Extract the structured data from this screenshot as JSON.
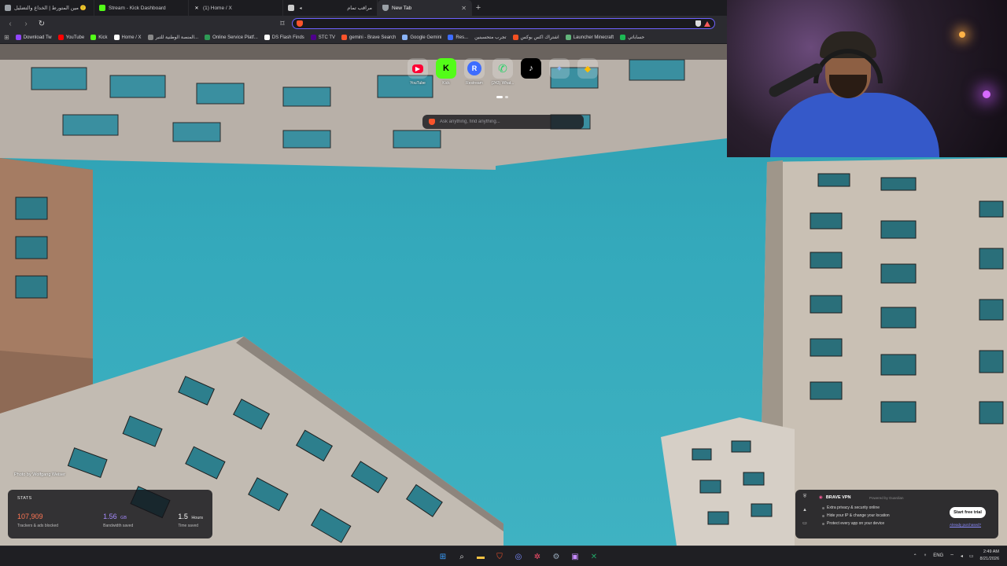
{
  "tabs": [
    {
      "title": "مين المتورط | الخداع والتضليل 🙂",
      "icon_color": "#9aa0a6",
      "active": false
    },
    {
      "title": "Stream - Kick Dashboard",
      "icon_color": "#53fc18",
      "active": false
    },
    {
      "title": "(1) Home / X",
      "icon_color": "#ffffff",
      "active": false
    },
    {
      "title": "مراقب تمام",
      "icon_color": "#cccccc",
      "active": false
    },
    {
      "title": "New Tab",
      "icon_color": "#9aa0a6",
      "active": true
    }
  ],
  "new_tab_symbol": "+",
  "close_symbol": "✕",
  "url": {
    "value": "",
    "placeholder": ""
  },
  "bookmarks": [
    {
      "label": "Download Tw",
      "color": "#9146ff"
    },
    {
      "label": "YouTube",
      "color": "#ff0000"
    },
    {
      "label": "Kick",
      "color": "#53fc18"
    },
    {
      "label": "Home / X",
      "color": "#ffffff"
    },
    {
      "label": "المنصة الوطنية للتبر...",
      "color": "#888888"
    },
    {
      "label": "Online Service Platf...",
      "color": "#2e9a55"
    },
    {
      "label": "DS Flash Finds",
      "color": "#ffffff"
    },
    {
      "label": "STC TV",
      "color": "#4f008c"
    },
    {
      "label": "gemini - Brave Search",
      "color": "#fb542b"
    },
    {
      "label": "Google Gemini",
      "color": "#8ab4f8"
    },
    {
      "label": "Res...",
      "color": "#3d6cff"
    },
    {
      "label": "تجرب متحسبنين",
      "color": "#ff9900"
    },
    {
      "label": "اشتراك اكس بوكس",
      "color": "#f25022"
    },
    {
      "label": "Launcher Minecraft",
      "color": "#62b47a"
    },
    {
      "label": "حساباتي",
      "color": "#1db954"
    }
  ],
  "top_sites": [
    {
      "label": "YouTube",
      "glyph": "▶",
      "bg": "#ff0033",
      "fg": "#ffffff"
    },
    {
      "label": "Kick",
      "glyph": "K",
      "bg": "#53fc18",
      "fg": "#000000"
    },
    {
      "label": "Restream",
      "glyph": "R",
      "bg": "#3d6cff",
      "fg": "#ffffff"
    },
    {
      "label": "(243) What...",
      "glyph": "✆",
      "bg": "#25d366",
      "fg": "#ffffff"
    },
    {
      "label": "",
      "glyph": "♪",
      "bg": "#000000",
      "fg": "#ffffff"
    },
    {
      "label": "",
      "glyph": "✦",
      "bg": "#8ab4f8",
      "fg": "#ffffff"
    },
    {
      "label": "",
      "glyph": "◆",
      "bg": "#34a853",
      "fg": "#fbbc04"
    }
  ],
  "search": {
    "placeholder": "Ask anything, find anything..."
  },
  "photo_credit": "Photo by Wolfgang Weiser",
  "stats": {
    "title": "STATS",
    "trackers": {
      "value": "107,909",
      "unit": "",
      "label": "Trackers & ads blocked"
    },
    "bandwidth": {
      "value": "1.56",
      "unit": "GB",
      "label": "Bandwidth saved"
    },
    "time": {
      "value": "1.5",
      "unit": "Hours",
      "label": "Time saved"
    }
  },
  "vpn": {
    "title": "BRAVE VPN",
    "powered": "Powered by Guardian",
    "features": [
      "Extra privacy & security online",
      "Hide your IP & change your location",
      "Protect every app on your device"
    ],
    "button": "Start free trial",
    "link": "Already purchased?"
  },
  "taskbar": {
    "lang": "ENG",
    "time": "2:49 AM",
    "date": "8/21/2026"
  }
}
